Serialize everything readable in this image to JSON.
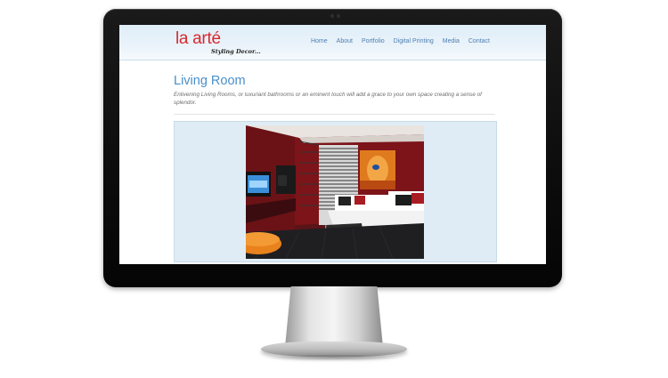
{
  "site": {
    "logo_text": "la arté",
    "logo_tagline": "Styling Decor..."
  },
  "nav": {
    "items": [
      {
        "label": "Home"
      },
      {
        "label": "About"
      },
      {
        "label": "Portfolio"
      },
      {
        "label": "Digital Printing"
      },
      {
        "label": "Media"
      },
      {
        "label": "Contact"
      }
    ]
  },
  "main": {
    "title": "Living Room",
    "description": "Enlivening Living Rooms, or luxuriant bathrooms or an eminent touch will add a grace to your own space creating a sense of splendor."
  },
  "colors": {
    "logo_red": "#d7292e",
    "nav_blue": "#4f7fb1",
    "title_blue": "#4a8fc8",
    "header_bg": "#e6f1f9",
    "gallery_bg": "#dfecf5"
  }
}
